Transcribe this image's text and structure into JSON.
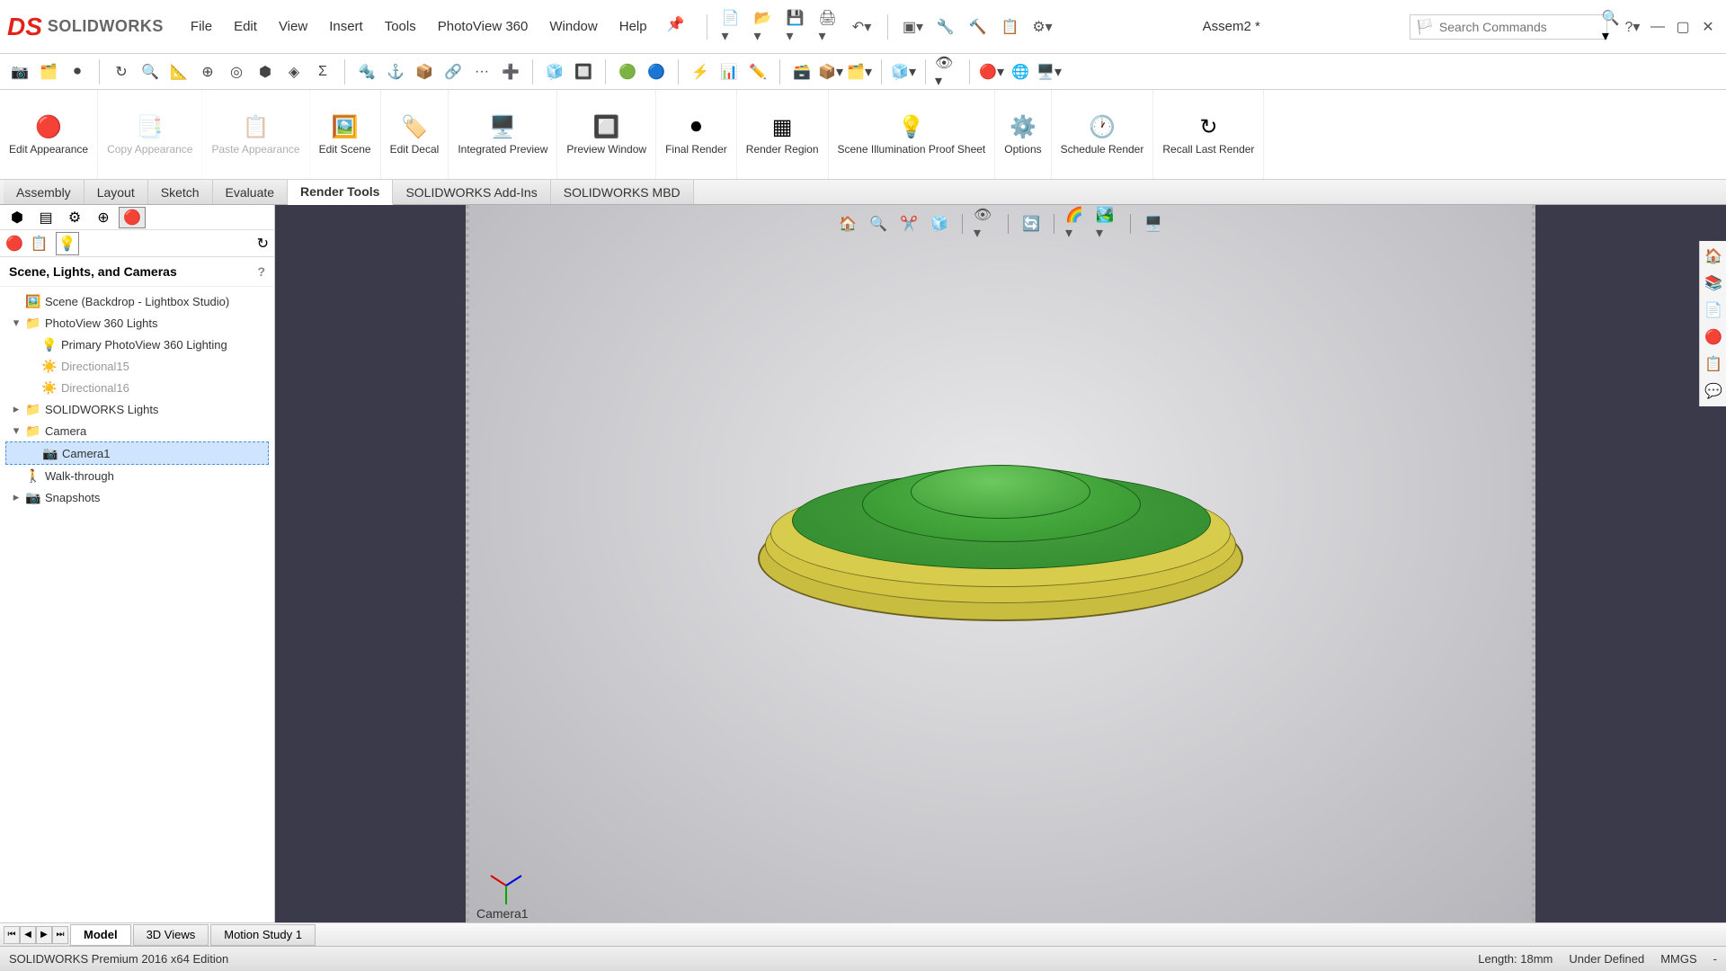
{
  "app": {
    "name": "SOLIDWORKS",
    "doc_title": "Assem2 *"
  },
  "menu": [
    "File",
    "Edit",
    "View",
    "Insert",
    "Tools",
    "PhotoView 360",
    "Window",
    "Help"
  ],
  "search": {
    "placeholder": "Search Commands"
  },
  "ribbon": [
    {
      "id": "edit-appearance",
      "label": "Edit\nAppearance",
      "disabled": false
    },
    {
      "id": "copy-appearance",
      "label": "Copy\nAppearance",
      "disabled": true
    },
    {
      "id": "paste-appearance",
      "label": "Paste\nAppearance",
      "disabled": true
    },
    {
      "id": "edit-scene",
      "label": "Edit\nScene",
      "disabled": false
    },
    {
      "id": "edit-decal",
      "label": "Edit\nDecal",
      "disabled": false
    },
    {
      "id": "integrated-preview",
      "label": "Integrated\nPreview",
      "disabled": false
    },
    {
      "id": "preview-window",
      "label": "Preview\nWindow",
      "disabled": false
    },
    {
      "id": "final-render",
      "label": "Final\nRender",
      "disabled": false
    },
    {
      "id": "render-region",
      "label": "Render\nRegion",
      "disabled": false
    },
    {
      "id": "scene-illum",
      "label": "Scene\nIllumination\nProof Sheet",
      "disabled": false
    },
    {
      "id": "options",
      "label": "Options",
      "disabled": false
    },
    {
      "id": "schedule-render",
      "label": "Schedule\nRender",
      "disabled": false
    },
    {
      "id": "recall-last",
      "label": "Recall\nLast\nRender",
      "disabled": false
    }
  ],
  "tabs": [
    "Assembly",
    "Layout",
    "Sketch",
    "Evaluate",
    "Render Tools",
    "SOLIDWORKS Add-Ins",
    "SOLIDWORKS MBD"
  ],
  "active_tab": "Render Tools",
  "feature_panel": {
    "title": "Scene, Lights, and Cameras",
    "tree": [
      {
        "indent": 0,
        "toggle": "",
        "icon": "🖼️",
        "label": "Scene (Backdrop - Lightbox Studio)"
      },
      {
        "indent": 0,
        "toggle": "▾",
        "icon": "📁",
        "label": "PhotoView 360 Lights"
      },
      {
        "indent": 1,
        "toggle": "",
        "icon": "💡",
        "label": "Primary PhotoView 360 Lighting"
      },
      {
        "indent": 1,
        "toggle": "",
        "icon": "☀️",
        "label": "Directional15",
        "dim": true
      },
      {
        "indent": 1,
        "toggle": "",
        "icon": "☀️",
        "label": "Directional16",
        "dim": true
      },
      {
        "indent": 0,
        "toggle": "▸",
        "icon": "📁",
        "label": "SOLIDWORKS Lights"
      },
      {
        "indent": 0,
        "toggle": "▾",
        "icon": "📁",
        "label": "Camera"
      },
      {
        "indent": 1,
        "toggle": "",
        "icon": "📷",
        "label": "Camera1",
        "selected": true
      },
      {
        "indent": 0,
        "toggle": "",
        "icon": "🚶",
        "label": "Walk-through"
      },
      {
        "indent": 0,
        "toggle": "▸",
        "icon": "📷",
        "label": "Snapshots"
      }
    ]
  },
  "viewport": {
    "camera_label": "Camera1"
  },
  "bottom_tabs": [
    "Model",
    "3D Views",
    "Motion Study 1"
  ],
  "active_bottom_tab": "Model",
  "status": {
    "left": "SOLIDWORKS Premium 2016 x64 Edition",
    "length": "Length: 18mm",
    "defined": "Under Defined",
    "units": "MMGS",
    "extra": "-"
  }
}
